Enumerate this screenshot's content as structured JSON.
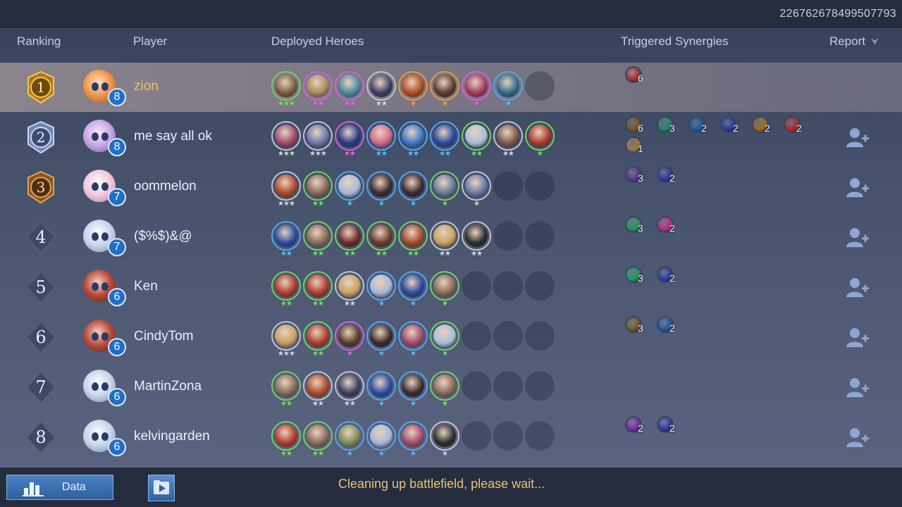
{
  "match_id": "226762678499507793",
  "headers": {
    "ranking": "Ranking",
    "player": "Player",
    "deployed_heroes": "Deployed Heroes",
    "triggered_synergies": "Triggered Synergies",
    "report": "Report"
  },
  "colors": {
    "selected_name": "#f0c35a",
    "star_green": "#6fe05f",
    "star_purple": "#e25ff0",
    "star_blue": "#59bff5",
    "star_gray": "#d4d6dc",
    "star_orange": "#f0a030",
    "level_badge": "#1f6fc8",
    "status_text": "#e8c27a"
  },
  "players": [
    {
      "rank": "1",
      "rank_style": "gold",
      "name": "zion",
      "level": "8",
      "avatar": "av-orange",
      "selected": true,
      "heroes": [
        {
          "q": "green",
          "face": "#7a5a3a",
          "stars": "★★★"
        },
        {
          "q": "purple",
          "face": "#a98a58",
          "stars": "★★"
        },
        {
          "q": "purple",
          "face": "#4b8a9a",
          "stars": "★★"
        },
        {
          "q": "gray",
          "face": "#3a3f5e",
          "stars": "★★"
        },
        {
          "q": "orange",
          "face": "#b04a1c",
          "stars": "★"
        },
        {
          "q": "orange",
          "face": "#5a3a2e",
          "stars": "★"
        },
        {
          "q": "purple",
          "face": "#a03a5a",
          "stars": "★"
        },
        {
          "q": "blue",
          "face": "#2e6a8a",
          "stars": "★"
        }
      ],
      "slots": 9,
      "synergies": [
        {
          "icon": "#b02a2a",
          "count": "6"
        }
      ],
      "report": false
    },
    {
      "rank": "2",
      "rank_style": "silver",
      "name": "me say all ok",
      "level": "8",
      "avatar": "av-lilac",
      "selected": false,
      "heroes": [
        {
          "q": "gray",
          "face": "#a04a6a",
          "stars": "★★★"
        },
        {
          "q": "gray",
          "face": "#6a7aa8",
          "stars": "★★★"
        },
        {
          "q": "purple",
          "face": "#2a3a8a",
          "stars": "★★"
        },
        {
          "q": "blue",
          "face": "#d06a8a",
          "stars": "★★"
        },
        {
          "q": "blue",
          "face": "#3a7ac8",
          "stars": "★★"
        },
        {
          "q": "blue",
          "face": "#2a4aa0",
          "stars": "★★"
        },
        {
          "q": "green",
          "face": "#a8c0d8",
          "stars": "★★"
        },
        {
          "q": "gray",
          "face": "#7a5a48",
          "stars": "★★"
        },
        {
          "q": "green",
          "face": "#b03a2a",
          "stars": "★"
        }
      ],
      "slots": 9,
      "synergies": [
        {
          "icon": "#7a5a1a",
          "count": "6"
        },
        {
          "icon": "#1f8a6a",
          "count": "3"
        },
        {
          "icon": "#1f5aa0",
          "count": "2"
        },
        {
          "icon": "#2a3aa0",
          "count": "2"
        },
        {
          "icon": "#a06a1a",
          "count": "2"
        },
        {
          "icon": "#b02a2a",
          "count": "2"
        },
        {
          "icon": "#a07a3a",
          "count": "1"
        }
      ],
      "report": true
    },
    {
      "rank": "3",
      "rank_style": "bronze",
      "name": "oommelon",
      "level": "7",
      "avatar": "av-pink",
      "selected": false,
      "heroes": [
        {
          "q": "gray",
          "face": "#b04a2a",
          "stars": "★★★"
        },
        {
          "q": "green",
          "face": "#8a6a58",
          "stars": "★★"
        },
        {
          "q": "blue",
          "face": "#a8b8d8",
          "stars": "★"
        },
        {
          "q": "blue",
          "face": "#3a2a28",
          "stars": "★"
        },
        {
          "q": "blue",
          "face": "#3a2a2e",
          "stars": "★"
        },
        {
          "q": "green",
          "face": "#6a7a98",
          "stars": "★"
        },
        {
          "q": "gray",
          "face": "#6a7aa8",
          "stars": "★"
        }
      ],
      "slots": 9,
      "synergies": [
        {
          "icon": "#5a3a8a",
          "count": "3"
        },
        {
          "icon": "#2a3aa0",
          "count": "2"
        }
      ],
      "report": true
    },
    {
      "rank": "4",
      "rank_style": "plain",
      "name": "($%$)&@",
      "level": "7",
      "avatar": "av-blue",
      "selected": false,
      "heroes": [
        {
          "q": "blue",
          "face": "#2a4aa0",
          "stars": "★★"
        },
        {
          "q": "green",
          "face": "#8a6a58",
          "stars": "★★"
        },
        {
          "q": "green",
          "face": "#6a2a2a",
          "stars": "★★"
        },
        {
          "q": "green",
          "face": "#6a3a2a",
          "stars": "★★"
        },
        {
          "q": "green",
          "face": "#a04a2a",
          "stars": "★★"
        },
        {
          "q": "gray",
          "face": "#c8a060",
          "stars": "★★"
        },
        {
          "q": "gray",
          "face": "#2a2e2a",
          "stars": "★★"
        }
      ],
      "slots": 9,
      "synergies": [
        {
          "icon": "#1f9a5a",
          "count": "3"
        },
        {
          "icon": "#c02a8a",
          "count": "2"
        }
      ],
      "report": true
    },
    {
      "rank": "5",
      "rank_style": "plain",
      "name": "Ken",
      "level": "6",
      "avatar": "av-red",
      "selected": false,
      "heroes": [
        {
          "q": "green",
          "face": "#b03a2a",
          "stars": "★★"
        },
        {
          "q": "green",
          "face": "#b03a2a",
          "stars": "★★"
        },
        {
          "q": "gray",
          "face": "#c8a060",
          "stars": "★★"
        },
        {
          "q": "blue",
          "face": "#a8b8d8",
          "stars": "★"
        },
        {
          "q": "blue",
          "face": "#2a4aa0",
          "stars": "★"
        },
        {
          "q": "green",
          "face": "#8a6a58",
          "stars": "★"
        }
      ],
      "slots": 9,
      "synergies": [
        {
          "icon": "#1f9a5a",
          "count": "3"
        },
        {
          "icon": "#2a3aa0",
          "count": "2"
        }
      ],
      "report": true
    },
    {
      "rank": "6",
      "rank_style": "plain",
      "name": "CindyTom",
      "level": "6",
      "avatar": "av-red",
      "selected": false,
      "heroes": [
        {
          "q": "gray",
          "face": "#c8a060",
          "stars": "★★★"
        },
        {
          "q": "green",
          "face": "#b03a2a",
          "stars": "★★"
        },
        {
          "q": "purple",
          "face": "#5a3a28",
          "stars": "★"
        },
        {
          "q": "blue",
          "face": "#3a2a28",
          "stars": "★"
        },
        {
          "q": "blue",
          "face": "#a04a6a",
          "stars": "★"
        },
        {
          "q": "green",
          "face": "#a8c0d8",
          "stars": "★"
        }
      ],
      "slots": 9,
      "synergies": [
        {
          "icon": "#7a5a1a",
          "count": "3"
        },
        {
          "icon": "#1f5aa0",
          "count": "2"
        }
      ],
      "report": true
    },
    {
      "rank": "7",
      "rank_style": "plain",
      "name": "MartinZona",
      "level": "6",
      "avatar": "av-blue",
      "selected": false,
      "heroes": [
        {
          "q": "green",
          "face": "#8a6a58",
          "stars": "★★"
        },
        {
          "q": "gray",
          "face": "#b04a2a",
          "stars": "★★"
        },
        {
          "q": "gray",
          "face": "#3a3f5e",
          "stars": "★★"
        },
        {
          "q": "blue",
          "face": "#2a4aa0",
          "stars": "★"
        },
        {
          "q": "blue",
          "face": "#3a2a2e",
          "stars": "★"
        },
        {
          "q": "green",
          "face": "#8a6a58",
          "stars": "★"
        }
      ],
      "slots": 9,
      "synergies": [],
      "report": true
    },
    {
      "rank": "8",
      "rank_style": "plain",
      "name": "kelvingarden",
      "level": "6",
      "avatar": "av-blue",
      "selected": false,
      "heroes": [
        {
          "q": "green",
          "face": "#b03a2a",
          "stars": "★★"
        },
        {
          "q": "green",
          "face": "#8a6a58",
          "stars": "★★"
        },
        {
          "q": "blue",
          "face": "#7a8a58",
          "stars": "★"
        },
        {
          "q": "blue",
          "face": "#a8b8d8",
          "stars": "★"
        },
        {
          "q": "blue",
          "face": "#a04a6a",
          "stars": "★"
        },
        {
          "q": "gray",
          "face": "#2a2e2a",
          "stars": "★"
        }
      ],
      "slots": 9,
      "synergies": [
        {
          "icon": "#7a2aa0",
          "count": "2"
        },
        {
          "icon": "#2a3aa0",
          "count": "2"
        }
      ],
      "report": true
    }
  ],
  "footer": {
    "data_label": "Data",
    "status": "Cleaning up battlefield, please wait..."
  }
}
